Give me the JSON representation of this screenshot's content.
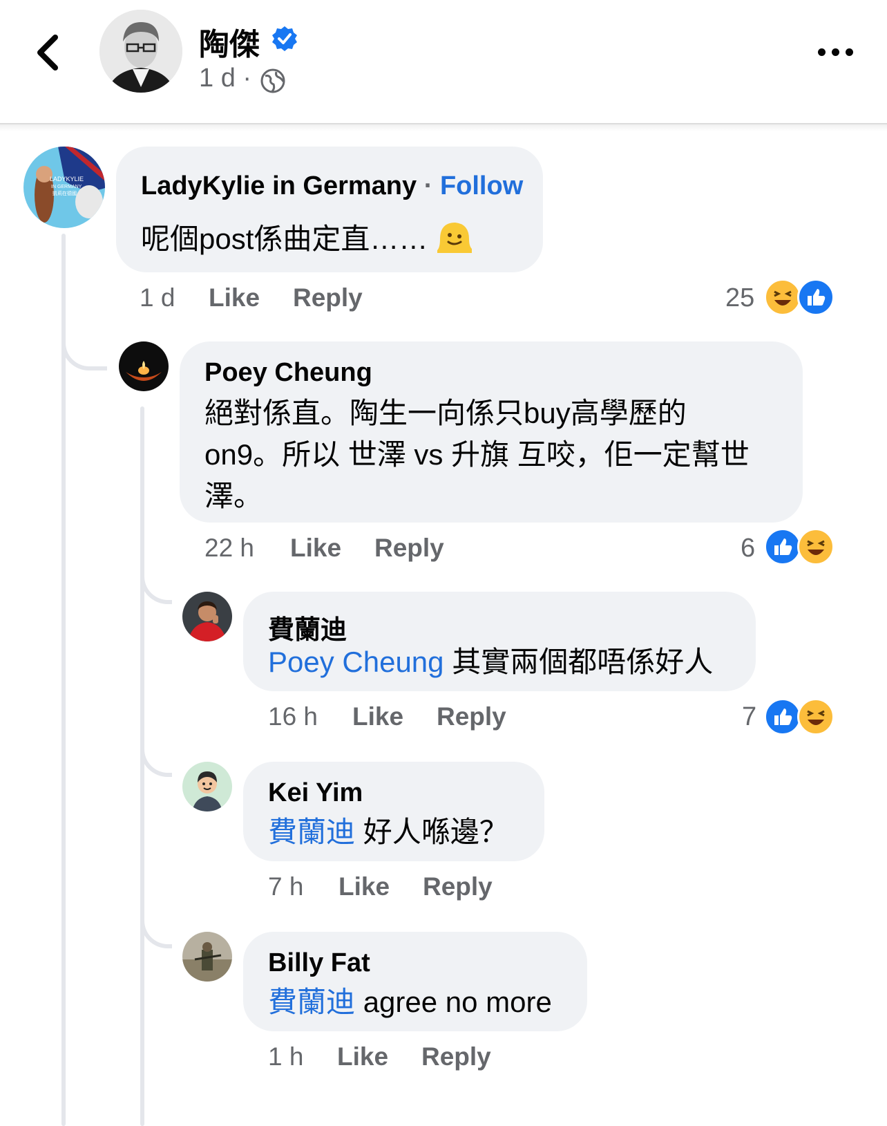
{
  "header": {
    "page_name": "陶傑",
    "time": "1 d ·",
    "verified_icon": "verified-badge-icon",
    "back_icon": "chevron-left-icon",
    "more_icon": "more-horizontal-icon"
  },
  "actions": {
    "like": "Like",
    "reply": "Reply"
  },
  "comments": [
    {
      "author": "LadyKylie in Germany",
      "follow_sep": "·",
      "follow": "Follow",
      "text": "呢個post係曲定直……",
      "emoji": "melting-face",
      "time": "1 d",
      "reaction_count": "25",
      "avatar_text": "LADYKYLIE",
      "avatar_subtext": "IN GERMANY",
      "avatar_subtext2": "凱莉在德國"
    },
    {
      "author": "Poey Cheung",
      "text_lines": [
        "絕對係直。陶生一向係只buy高學歷的",
        "on9。所以 世澤 vs 升旗 互咬，佢一定幫世",
        "澤。"
      ],
      "time": "22 h",
      "reaction_count": "6"
    },
    {
      "author": "費蘭迪",
      "mention": "Poey Cheung",
      "text": "其實兩個都唔係好人",
      "time": "16 h",
      "reaction_count": "7"
    },
    {
      "author": "Kei Yim",
      "mention": "費蘭迪",
      "text": "好人喺邊？",
      "time": "7 h"
    },
    {
      "author": "Billy Fat",
      "mention": "費蘭迪",
      "text": "agree no more",
      "time": "1 h"
    }
  ],
  "colors": {
    "link": "#216fdb",
    "muted": "#65676b",
    "bubble": "#f0f2f5",
    "like_blue": "#1877f2"
  }
}
